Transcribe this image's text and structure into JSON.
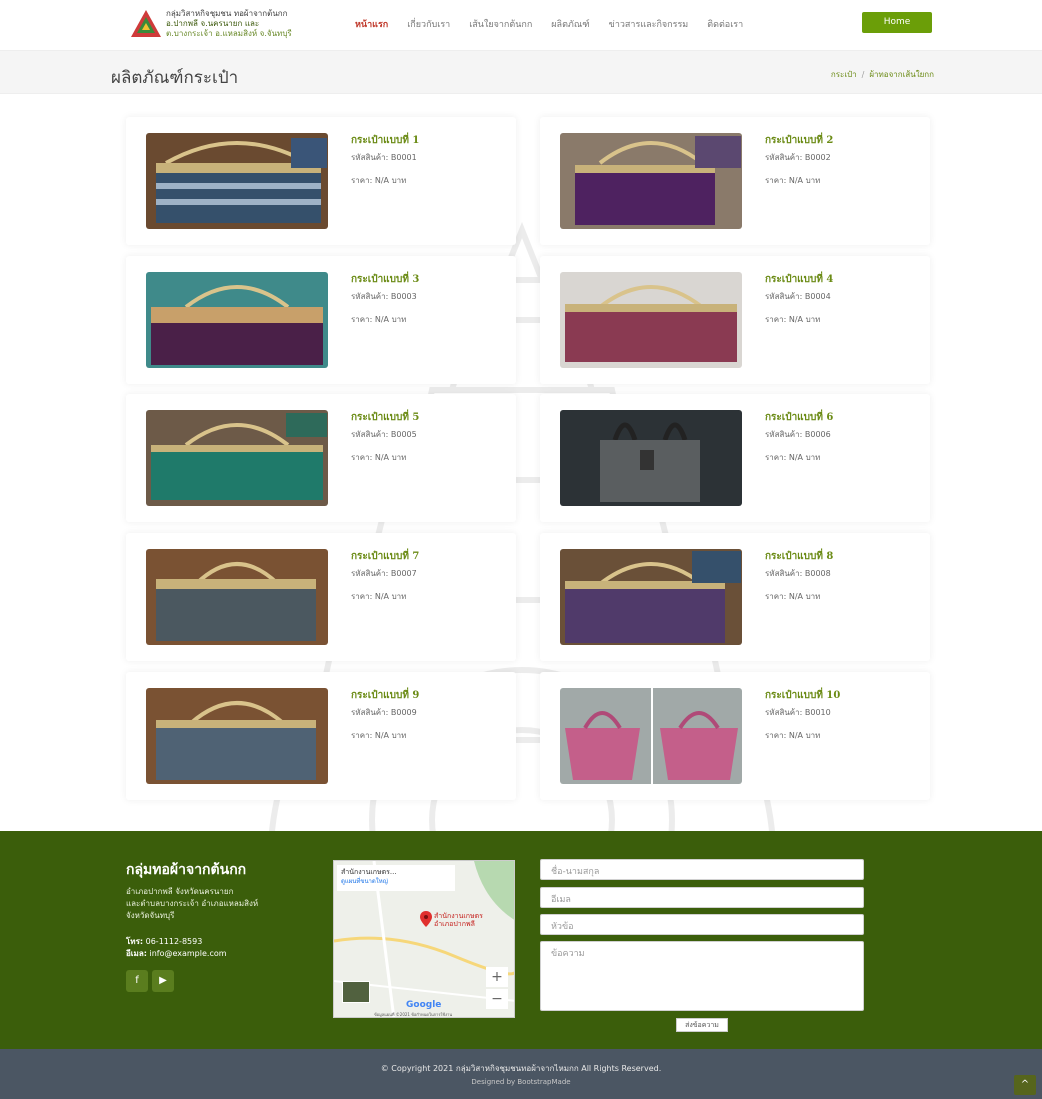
{
  "header": {
    "brand_line1": "กลุ่มวิสาหกิจชุมชน ทอผ้าจากต้นกก",
    "brand_line2": "อ.ปากพลี จ.นครนายก และ",
    "brand_line3": "ต.บางกระเจ้า อ.แหลมสิงห์ จ.จันทบุรี",
    "nav": [
      "หน้าแรก",
      "เกี่ยวกับเรา",
      "เส้นใยจากต้นกก",
      "ผลิตภัณฑ์",
      "ข่าวสารและกิจกรรม",
      "ติดต่อเรา"
    ],
    "home_button": "Home"
  },
  "titlebar": {
    "title": "ผลิตภัณฑ์กระเป๋า",
    "breadcrumb": [
      "กระเป๋า",
      "ผ้าทอจากเส้นใยกก"
    ],
    "breadcrumb_sep": "/"
  },
  "products": [
    {
      "name": "กระเป๋าแบบที่ 1",
      "code": "รหัสสินค้า: B0001",
      "price": "ราคา: N/A บาท",
      "color": "#35506b"
    },
    {
      "name": "กระเป๋าแบบที่ 2",
      "code": "รหัสสินค้า: B0002",
      "price": "ราคา: N/A บาท",
      "color": "#4e2260"
    },
    {
      "name": "กระเป๋าแบบที่ 3",
      "code": "รหัสสินค้า: B0003",
      "price": "ราคา: N/A บาท",
      "color": "#4a2048"
    },
    {
      "name": "กระเป๋าแบบที่ 4",
      "code": "รหัสสินค้า: B0004",
      "price": "ราคา: N/A บาท",
      "color": "#8a3a52"
    },
    {
      "name": "กระเป๋าแบบที่ 5",
      "code": "รหัสสินค้า: B0005",
      "price": "ราคา: N/A บาท",
      "color": "#1f7a6a"
    },
    {
      "name": "กระเป๋าแบบที่ 6",
      "code": "รหัสสินค้า: B0006",
      "price": "ราคา: N/A บาท",
      "color": "#5a5e60"
    },
    {
      "name": "กระเป๋าแบบที่ 7",
      "code": "รหัสสินค้า: B0007",
      "price": "ราคา: N/A บาท",
      "color": "#4b5860"
    },
    {
      "name": "กระเป๋าแบบที่ 8",
      "code": "รหัสสินค้า: B0008",
      "price": "ราคา: N/A บาท",
      "color": "#503a6a"
    },
    {
      "name": "กระเป๋าแบบที่ 9",
      "code": "รหัสสินค้า: B0009",
      "price": "ราคา: N/A บาท",
      "color": "#4f6274"
    },
    {
      "name": "กระเป๋าแบบที่ 10",
      "code": "รหัสสินค้า: B0010",
      "price": "ราคา: N/A บาท",
      "color": "#c45f8a"
    }
  ],
  "footer": {
    "title": "กลุ่มทอผ้าจากต้นกก",
    "address_line1": "อำเภอปากพลี จังหวัดนครนายก",
    "address_line2": "และตำบลบางกระเจ้า อำเภอแหลมสิงห์",
    "address_line3": "จังหวัดจันทบุรี",
    "phone_label": "โทร:",
    "phone": "06-1112-8593",
    "email_label": "อีเมล:",
    "email": "info@example.com",
    "social": [
      "f",
      "▶"
    ],
    "map": {
      "place": "สำนักงานเกษตร...",
      "link": "ดูแผนที่ขนาดใหญ่",
      "pin_label1": "สำนักงานเกษตร",
      "pin_label2": "อำเภอปากพลี",
      "zoom_in": "+",
      "zoom_out": "−",
      "google": "Google",
      "footer_text": "ข้อมูลแผนที่ ©2021   ข้อกำหนดในการใช้งาน"
    },
    "form": {
      "name_placeholder": "ชื่อ-นามสกุล",
      "email_placeholder": "อีเมล",
      "subject_placeholder": "หัวข้อ",
      "message_placeholder": "ข้อความ",
      "send": "ส่งข้อความ"
    }
  },
  "bottom": {
    "copyright": "© Copyright 2021 กลุ่มวิสาหกิจชุมชนทอผ้าจากไหมกก All Rights Reserved.",
    "designed": "Designed by BootstrapMade",
    "totop": "^"
  },
  "colors": {
    "brand_green": "#6b9e08",
    "footer_green": "#3b5e0b",
    "bottom_gray": "#4b5663",
    "accent_red": "#c0392b"
  }
}
